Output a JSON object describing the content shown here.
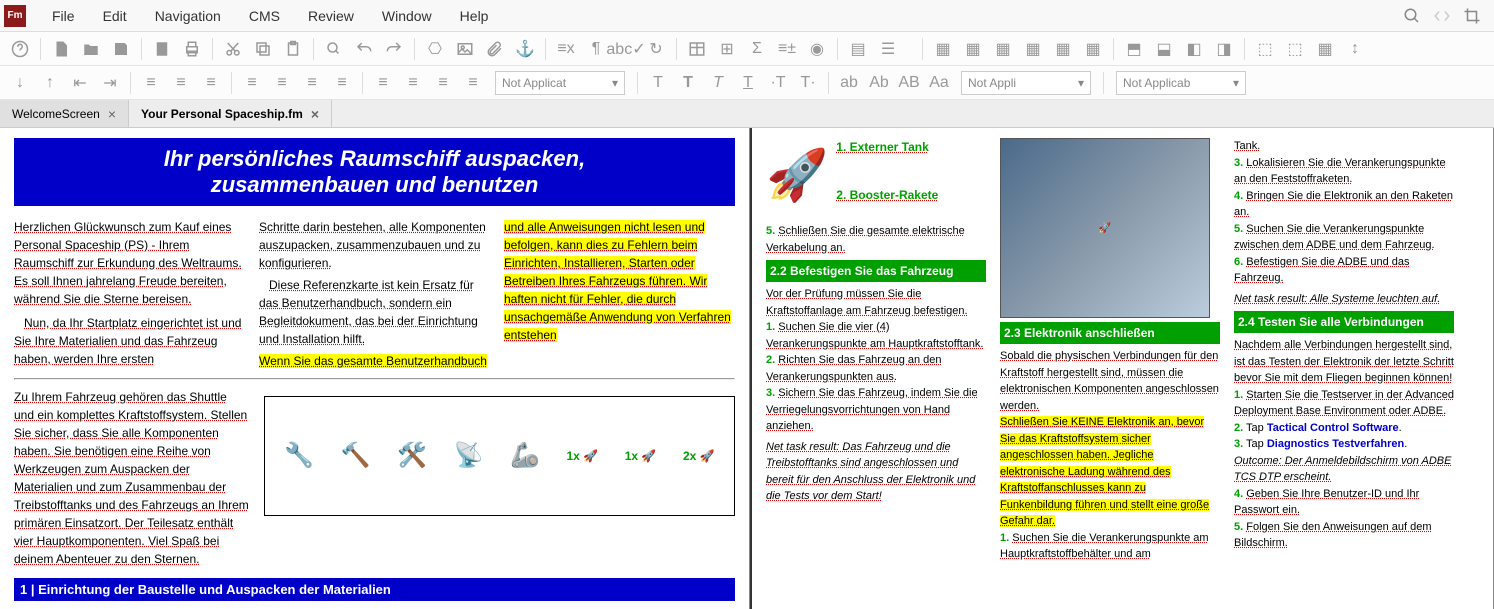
{
  "menu": {
    "file": "File",
    "edit": "Edit",
    "navigation": "Navigation",
    "cms": "CMS",
    "review": "Review",
    "window": "Window",
    "help": "Help"
  },
  "app_logo": "Fm",
  "toolbar_selects": {
    "s1": "Not Applicat",
    "s2": "Not Appli",
    "s3": "Not Applicab"
  },
  "tabs": {
    "t1": "WelcomeScreen",
    "t2": "Your Personal Spaceship.fm"
  },
  "doc": {
    "title_line1": "Ihr persönliches Raumschiff auspacken,",
    "title_line2": "zusammenbauen und benutzen",
    "p1": "Herzlichen Glückwunsch zum Kauf eines Personal Spaceship (PS) - Ihrem Raumschiff zur Erkundung des Weltraums. Es soll Ihnen jahrelang Freude bereiten, während Sie die Sterne bereisen.",
    "p2": "Nun, da Ihr Startplatz eingerichtet ist und Sie Ihre Materialien und das Fahrzeug haben, werden Ihre ersten",
    "p3": "Zu Ihrem Fahrzeug gehören das Shuttle und ein komplettes Kraftstoffsystem. Stellen Sie sicher, dass Sie alle Komponenten haben. Sie benötigen eine Reihe von Werkzeugen zum Auspacken der Materialien und zum Zusammenbau der Treibstofftanks und des Fahrzeugs an Ihrem primären Einsatzort. Der Teilesatz enthält vier Hauptkomponenten. Viel Spaß bei deinem Abenteuer zu den Sternen.",
    "p4": "Schritte darin bestehen, alle Komponenten auszupacken, zusammenzubauen und zu konfigurieren.",
    "p5": "Diese Referenzkarte ist kein Ersatz für das Benutzerhandbuch, sondern ein Begleitdokument, das bei der Einrichtung und Installation hilft.",
    "p6": "Wenn Sie das gesamte Benutzerhandbuch",
    "p7": "und alle Anweisungen nicht lesen und befolgen, kann dies zu Fehlern beim Einrichten, Installieren, Starten oder Betreiben Ihres Fahrzeugs führen. Wir haften nicht für Fehler, die durch unsachgemäße Anwendung von Verfahren entstehen",
    "section1": "1 | Einrichtung der Baustelle und Auspacken der Materialien",
    "qty1": "1x",
    "qty2": "1x",
    "qty3": "2x",
    "ext_tank": "1. Externer Tank",
    "booster": "2. Booster-Rakete",
    "step5": "Schließen Sie die gesamte elektrische Verkabelung an.",
    "sec22": "2.2 Befestigen Sie das Fahrzeug",
    "sec22_intro": "Vor der Prüfung müssen Sie die Kraftstoffanlage am Fahrzeug befestigen.",
    "sec22_1": "Suchen Sie die vier (4) Verankerungspunkte am Hauptkraftstofftank.",
    "sec22_2": "Richten Sie das Fahrzeug an den Verankerungspunkten aus.",
    "sec22_3": "Sichern Sie das Fahrzeug, indem Sie die Verriegelungsvorrichtungen von Hand anziehen.",
    "nt1": "Net task result: Das Fahrzeug und die Treibstofftanks sind angeschlossen und bereit für den Anschluss der Elektronik und die Tests vor dem Start!",
    "sec23": "2.3 Elektronik anschließen",
    "sec23_p1": "Sobald die physischen Verbindungen für den Kraftstoff hergestellt sind, müssen die elektronischen Komponenten angeschlossen werden.",
    "sec23_hl": "Schließen Sie KEINE Elektronik an, bevor Sie das Kraftstoffsystem sicher angeschlossen haben. Jegliche elektronische Ladung während des Kraftstoffanschlusses kann zu Funkenbildung führen und stellt eine große Gefahr dar.",
    "sec23_1": "Suchen Sie die Verankerungspunkte am Hauptkraftstoffbehälter und am",
    "r_tank": "Tank.",
    "r3": "Lokalisieren Sie die Verankerungspunkte an den Feststoffraketen.",
    "r4": "Bringen Sie die Elektronik an den Raketen an.",
    "r5": "Suchen Sie die Verankerungspunkte zwischen dem ADBE und dem Fahrzeug.",
    "r6": "Befestigen Sie die ADBE und das Fahrzeug.",
    "nt2": "Net task result: Alle Systeme leuchten auf.",
    "sec24": "2.4 Testen Sie alle Verbindungen",
    "sec24_intro": "Nachdem alle Verbindungen hergestellt sind, ist das Testen der Elektronik der letzte Schritt bevor Sie mit dem Fliegen beginnen können!",
    "sec24_1": "Starten Sie die Testserver in der Advanced Deployment Base Environment oder ADBE.",
    "sec24_2": "Tap Tactical Control Software.",
    "sec24_3": "Tap Diagnostics Testverfahren.",
    "sec24_3b": "Outcome: Der Anmeldebildschirm von ADBE TCS DTP erscheint.",
    "sec24_4": "Geben Sie Ihre Benutzer-ID und Ihr Passwort ein.",
    "sec24_5": "Folgen Sie den Anweisungen auf dem Bildschirm."
  }
}
